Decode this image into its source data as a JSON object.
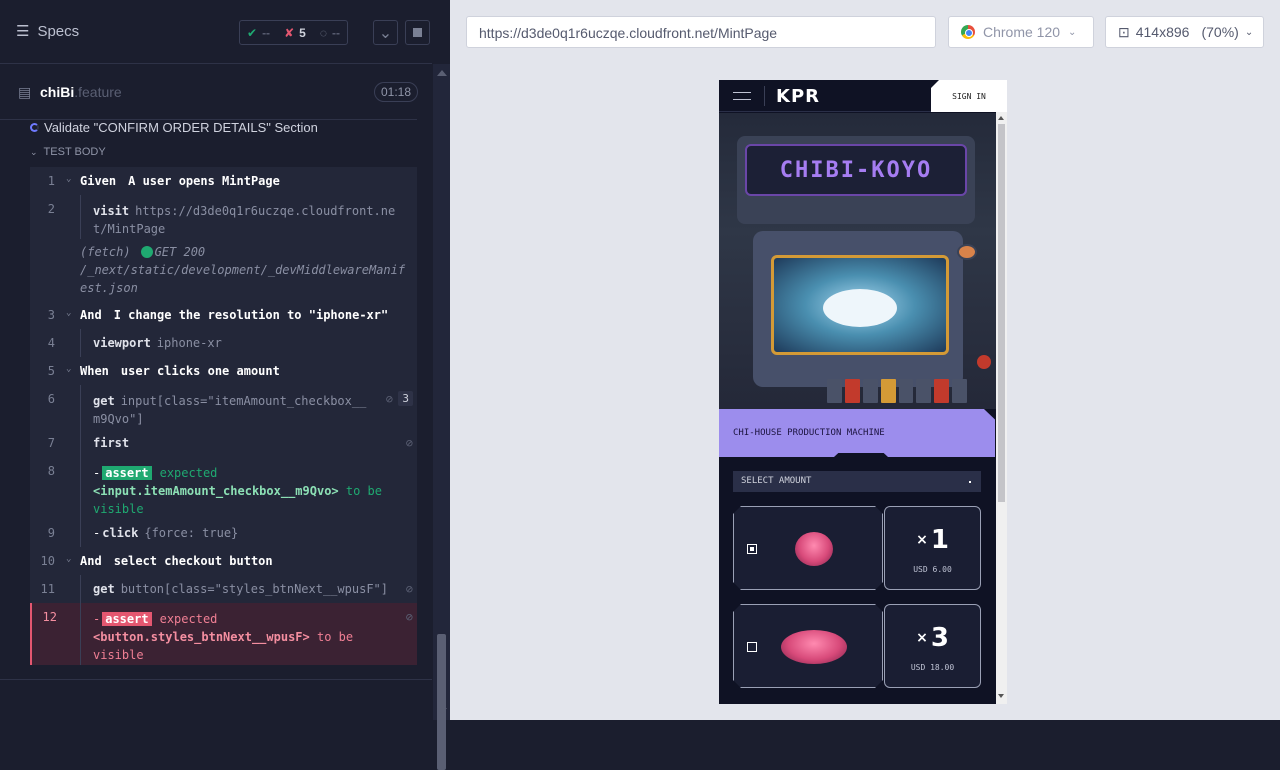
{
  "reporter": {
    "specs_label": "Specs",
    "stats": {
      "passed": "--",
      "failed": "5",
      "pending": "--"
    },
    "file": {
      "name": "chiBi",
      "ext": ".feature",
      "duration": "01:18"
    },
    "suite_title": "Validate \"CONFIRM ORDER DETAILS\" Section",
    "test_body_label": "TEST BODY",
    "commands": [
      {
        "num": "1",
        "keyword": "Given",
        "text": "A user opens MintPage"
      },
      {
        "num": "2",
        "name": "visit",
        "msg": "https://d3de0q1r6uczqe.cloudfront.net/MintPage"
      },
      {
        "fetch_label": "(fetch)",
        "fetch_msg": "GET 200",
        "fetch_url": "/_next/static/development/_devMiddlewareManifest.json"
      },
      {
        "num": "3",
        "keyword": "And",
        "text": "I change the resolution to \"iphone-xr\""
      },
      {
        "num": "4",
        "name": "viewport",
        "msg": "iphone-xr"
      },
      {
        "num": "5",
        "keyword": "When",
        "text": "user clicks one amount"
      },
      {
        "num": "6",
        "name": "get",
        "msg": "input[class=\"itemAmount_checkbox__m9Qvo\"]",
        "badge": "3"
      },
      {
        "num": "7",
        "name": "first"
      },
      {
        "num": "8",
        "assert": "assert",
        "pre": "expected",
        "subject": "<input.itemAmount_checkbox__m9Qvo>",
        "post": "to be visible"
      },
      {
        "num": "9",
        "name": "click",
        "msg": "{force: true}"
      },
      {
        "num": "10",
        "keyword": "And",
        "text": "select checkout button"
      },
      {
        "num": "11",
        "name": "get",
        "msg": "button[class=\"styles_btnNext__wpusF\"]"
      },
      {
        "num": "12",
        "assert": "assert",
        "pre": "expected",
        "subject": "<button.styles_btnNext__wpusF>",
        "post": "to be visible"
      }
    ]
  },
  "aut": {
    "url": "https://d3de0q1r6uczqe.cloudfront.net/MintPage",
    "browser": "Chrome 120",
    "viewport": "414x896",
    "zoom": "(70%)"
  },
  "app": {
    "logo": "KPR",
    "sign_in": "SIGN IN",
    "machine_title": "CHI-HOUSE PRODUCTION MACHINE",
    "screen_text": "CHIBI-KOYO",
    "select_amount": "SELECT AMOUNT",
    "options": [
      {
        "qty": "1",
        "price": "USD 6.00",
        "checked": true
      },
      {
        "qty": "3",
        "price": "USD 18.00",
        "checked": false
      }
    ]
  },
  "colors": {
    "pass": "#1fa971",
    "fail": "#e45770",
    "accent": "#9c8ded"
  }
}
